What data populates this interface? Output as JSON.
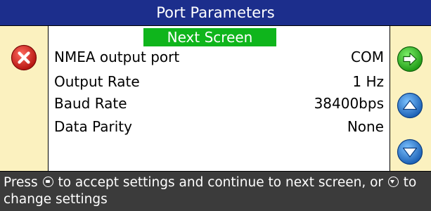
{
  "title": "Port Parameters",
  "next_screen_label": "Next Screen",
  "rows": [
    {
      "label": "NMEA output port",
      "value": "COM"
    },
    {
      "label": "Output Rate",
      "value": "1 Hz"
    },
    {
      "label": "Baud Rate",
      "value": "38400bps"
    },
    {
      "label": "Data Parity",
      "value": "None"
    }
  ],
  "footer": {
    "part1": "Press ",
    "part2": " to accept settings and continue to next screen, or ",
    "part3": " to change settings"
  },
  "icons": {
    "cancel": "close-icon",
    "next": "arrow-right-icon",
    "up": "arrow-up-icon",
    "down": "arrow-down-icon"
  },
  "colors": {
    "title_bar": "#1c2e8c",
    "side_panel": "#fbf1bf",
    "next_button": "#0fb51c",
    "cancel_button": "#d6261d",
    "next_arrow_button": "#2fbf24",
    "up_down_buttons": "#2a7fd4",
    "footer": "#3b3b3b"
  }
}
